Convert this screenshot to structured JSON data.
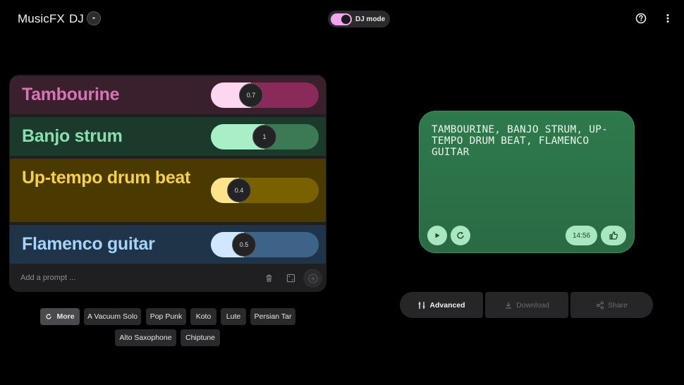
{
  "header": {
    "app_title": "MusicFX",
    "mode": "DJ",
    "dj_toggle_label": "DJ mode",
    "dj_mode_on": true
  },
  "prompts": [
    {
      "text": "Tambourine",
      "weight": "0.7",
      "weight_value": 0.7,
      "color": "#d774b6"
    },
    {
      "text": "Banjo strum",
      "weight": "1",
      "weight_value": 1.0,
      "color": "#8adfae"
    },
    {
      "text": "Up-tempo drum beat",
      "weight": "0.4",
      "weight_value": 0.4,
      "color": "#f6d048"
    },
    {
      "text": "Flamenco guitar",
      "weight": "0.5",
      "weight_value": 0.5,
      "color": "#a6d3f8"
    }
  ],
  "add_prompt": {
    "placeholder": "Add a prompt ..."
  },
  "suggestions": {
    "more_label": "More",
    "chips": [
      "A Vacuum Solo",
      "Pop Punk",
      "Koto",
      "Lute",
      "Persian Tar",
      "Alto Saxophone",
      "Chiptune"
    ]
  },
  "now_playing": {
    "title": "TAMBOURINE, BANJO STRUM, UP-TEMPO DRUM BEAT, FLAMENCO GUITAR",
    "time": "14:56"
  },
  "actions": {
    "advanced": "Advanced",
    "download": "Download",
    "share": "Share"
  },
  "icons": [
    "chevron-down-icon",
    "help-icon",
    "more-vert-icon",
    "trash-icon",
    "dice-icon",
    "add-icon",
    "refresh-icon",
    "play-icon",
    "replay-icon",
    "thumb-up-icon",
    "tune-icon",
    "download-icon",
    "share-icon"
  ]
}
